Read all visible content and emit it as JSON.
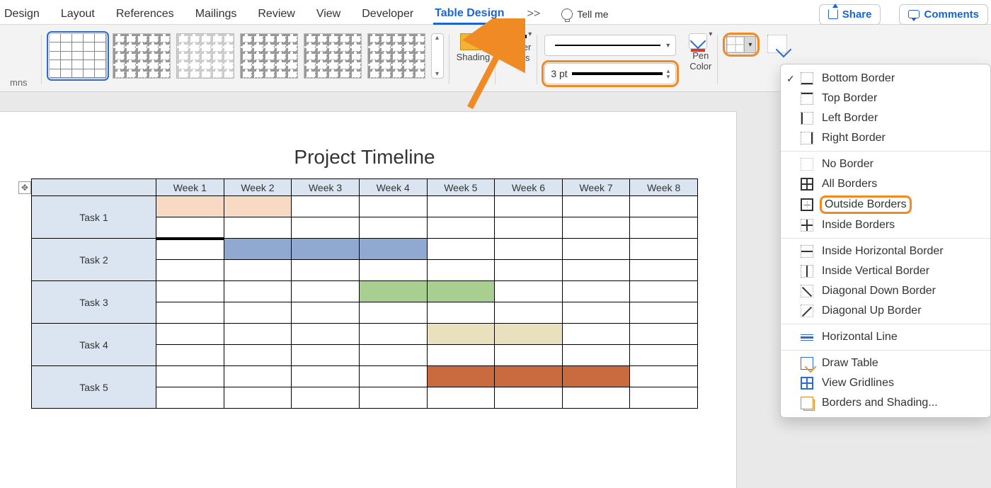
{
  "menu": {
    "items": [
      "Design",
      "Layout",
      "References",
      "Mailings",
      "Review",
      "View",
      "Developer",
      "Table Design"
    ],
    "active_index": 7,
    "more": ">>",
    "tell_me": "Tell me",
    "share": "Share",
    "comments": "Comments"
  },
  "toolbar": {
    "columns_label": "mns",
    "shading_label": "Shading",
    "shading_color": "#f2b531",
    "border_styles_label": "Border\nStyles",
    "weight_value": "3 pt",
    "pen_color_label": "Pen\nColor",
    "pen_underline_color": "#d93a2b"
  },
  "borders_menu": {
    "groups": [
      [
        {
          "label": "Bottom Border",
          "icon": "bottom",
          "checked": true
        },
        {
          "label": "Top Border",
          "icon": "top"
        },
        {
          "label": "Left Border",
          "icon": "left"
        },
        {
          "label": "Right Border",
          "icon": "right"
        }
      ],
      [
        {
          "label": "No Border",
          "icon": "none"
        },
        {
          "label": "All Borders",
          "icon": "all"
        },
        {
          "label": "Outside Borders",
          "icon": "outside",
          "highlighted": true
        },
        {
          "label": "Inside Borders",
          "icon": "inside"
        }
      ],
      [
        {
          "label": "Inside Horizontal Border",
          "icon": "ih"
        },
        {
          "label": "Inside Vertical Border",
          "icon": "iv"
        },
        {
          "label": "Diagonal Down Border",
          "icon": "diag-dn"
        },
        {
          "label": "Diagonal Up Border",
          "icon": "diag-up"
        }
      ],
      [
        {
          "label": "Horizontal Line",
          "icon": "hline"
        }
      ],
      [
        {
          "label": "Draw Table",
          "icon": "draw"
        },
        {
          "label": "View Gridlines",
          "icon": "grid"
        },
        {
          "label": "Borders and Shading...",
          "icon": "bs"
        }
      ]
    ]
  },
  "document": {
    "title": "Project Timeline",
    "weeks": [
      "Week 1",
      "Week 2",
      "Week 3",
      "Week 4",
      "Week 5",
      "Week 6",
      "Week 7",
      "Week 8"
    ],
    "tasks": [
      "Task 1",
      "Task 2",
      "Task 3",
      "Task 4",
      "Task 5"
    ],
    "gantt": [
      {
        "task": "Task 1",
        "start": 1,
        "end": 2,
        "color": "c-orange"
      },
      {
        "task": "Task 2",
        "start": 2,
        "end": 4,
        "color": "c-blue"
      },
      {
        "task": "Task 3",
        "start": 4,
        "end": 5,
        "color": "c-green"
      },
      {
        "task": "Task 4",
        "start": 5,
        "end": 6,
        "color": "c-tan"
      },
      {
        "task": "Task 5",
        "start": 5,
        "end": 7,
        "color": "c-rust"
      }
    ]
  },
  "highlight_color": "#f08a24"
}
